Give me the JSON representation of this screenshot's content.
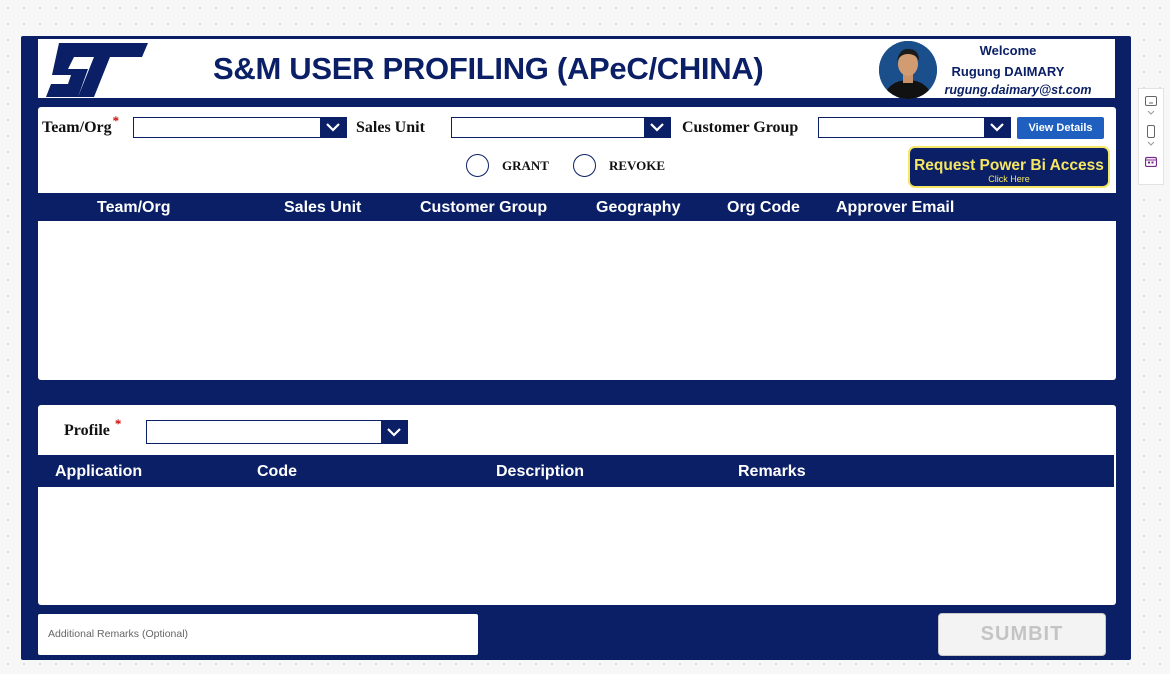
{
  "header": {
    "title": "S&M USER PROFILING (APeC/CHINA)",
    "logo_text": "ST",
    "welcome": "Welcome",
    "user_name": "Rugung DAIMARY",
    "user_email": "rugung.daimary@st.com"
  },
  "filters": {
    "team_org_label": "Team/Org",
    "sales_unit_label": "Sales Unit",
    "customer_group_label": "Customer Group",
    "required_mark": "*",
    "team_org_value": "",
    "sales_unit_value": "",
    "customer_group_value": "",
    "view_details": "View Details"
  },
  "access": {
    "grant": "GRANT",
    "revoke": "REVOKE",
    "selected": null
  },
  "power_bi": {
    "label": "Request Power Bi Access",
    "sub_label": "Click Here"
  },
  "org_table": {
    "columns": [
      "Team/Org",
      "Sales Unit",
      "Customer Group",
      "Geography",
      "Org Code",
      "Approver Email"
    ],
    "rows": []
  },
  "profile": {
    "label": "Profile",
    "required_mark": "*",
    "value": ""
  },
  "app_table": {
    "columns": [
      "Application",
      "Code",
      "Description",
      "Remarks"
    ],
    "rows": []
  },
  "remarks": {
    "placeholder": "Additional Remarks (Optional)"
  },
  "submit_label": "SUMBIT",
  "colors": {
    "navy": "#0b1f66",
    "accent_blue": "#1f5fbf",
    "highlight_yellow": "#f5e663",
    "required_red": "#cc0000"
  },
  "icons": [
    "st-logo",
    "chevron-down-icon",
    "radio-icon",
    "tablet-icon",
    "phone-icon",
    "calendar-icon"
  ]
}
